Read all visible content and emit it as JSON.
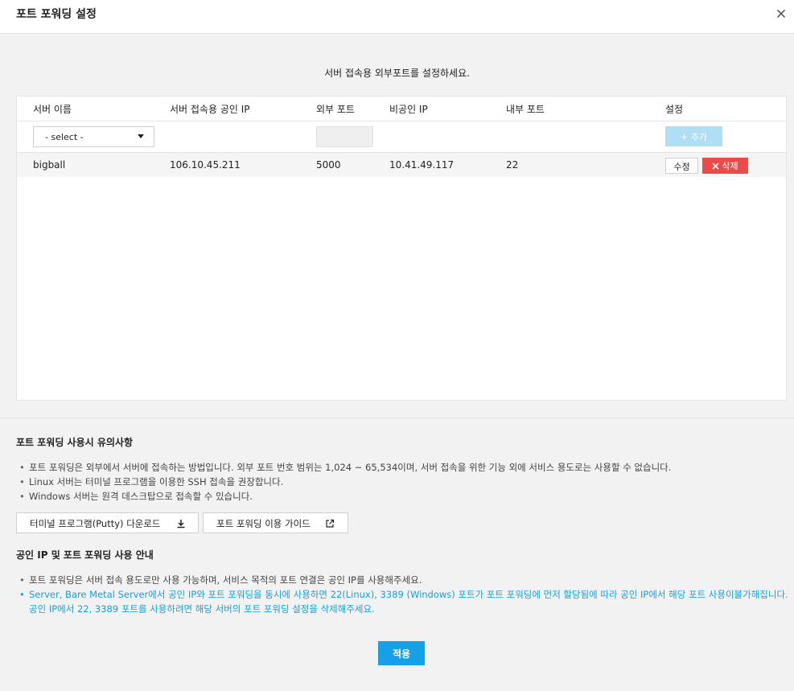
{
  "dialog": {
    "title": "포트 포워딩 설정"
  },
  "intro": "서버 접속용 외부포트를 설정하세요.",
  "table": {
    "headers": [
      "서버 이름",
      "서버 접속용 공인 IP",
      "외부 포트",
      "비공인 IP",
      "내부 포트",
      "설정"
    ],
    "select_value": "- select -",
    "add_label": "+ 추가",
    "rows": [
      {
        "server": "bigball",
        "public_ip": "106.10.45.211",
        "ext_port": "5000",
        "private_ip": "10.41.49.117",
        "int_port": "22",
        "edit_label": "수정",
        "delete_label": "삭제"
      }
    ]
  },
  "caution": {
    "title": "포트 포워딩 사용시 유의사항",
    "items": [
      "포트 포워딩은 외부에서 서버에 접속하는 방법입니다. 외부 포트 번호 범위는 1,024 ~ 65,534이며, 서버 접속을 위한 기능 외에 서비스 용도로는 사용할 수 없습니다.",
      "Linux 서버는 터미널 프로그램을 이용한 SSH 접속을 권장합니다.",
      "Windows 서버는 원격 데스크탑으로 접속할 수 있습니다."
    ],
    "download_label": "터미널 프로그램(Putty) 다운로드",
    "guide_label": "포트 포워딩 이용 가이드"
  },
  "guide": {
    "title": "공인 IP 및 포트 포워딩 사용 안내",
    "items": [
      "포트 포워딩은 서버 접속 용도로만 사용 가능하며, 서비스 목적의 포트 연결은 공인 IP를 사용해주세요.",
      "Server, Bare Metal Server에서 공인 IP와 포트 포워딩을 동시에 사용하면 22(Linux), 3389 (Windows) 포트가 포트 포워딩에 먼저 할당됨에 따라 공인 IP에서 해당 포트 사용이불가해집니다. 공인 IP에서 22, 3389 포트를 사용하려면 해당 서버의 포트 포워딩 설정을 삭제해주세요."
    ]
  },
  "apply_label": "적용",
  "colors": {
    "accent": "#16a1e6",
    "danger": "#ef4a4a",
    "add_disabled": "#aedff5",
    "highlight_text": "#16a1d9"
  }
}
